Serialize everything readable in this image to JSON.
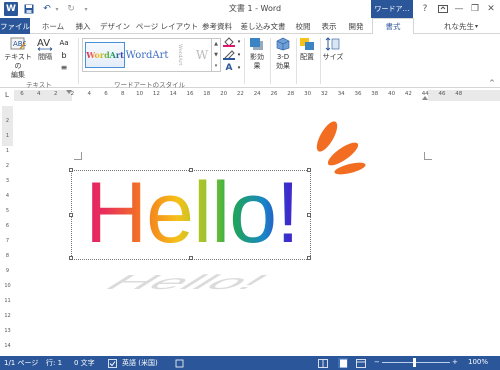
{
  "titlebar": {
    "title": "文書 1 - Word",
    "context_title": "ワードア…",
    "help": "?",
    "minimize": "—",
    "restore": "❐",
    "close": "✕"
  },
  "qat": {
    "word_glyph": "W",
    "save_glyph": "💾",
    "undo_glyph": "↶",
    "redo_glyph": "↻",
    "more_glyph": "▾"
  },
  "tabs": [
    "ファイル",
    "ホーム",
    "挿入",
    "デザイン",
    "ページ レイアウト",
    "参考資料",
    "差し込み文書",
    "校閲",
    "表示",
    "開発",
    "書式"
  ],
  "user_label": "れな先生",
  "ribbon": {
    "text_edit_label": "テキストの\n編集",
    "spacing_label": "間隔",
    "text_group": "テキスト",
    "wordart_group": "ワードアートのスタイル",
    "shadow_label": "影効果",
    "threed_label": "3-D\n効果",
    "arrange_label": "配置",
    "size_label": "サイズ",
    "gallery": [
      "WordArt",
      "WordArt",
      "WordArt",
      "W"
    ],
    "colors": {
      "accent": "#2b579a",
      "fill": "#e0156b",
      "outline": "#2b579a",
      "shadow": "#3b84c4"
    }
  },
  "ruler": {
    "h_ticks": [
      "6",
      "4",
      "2",
      "2",
      "4",
      "6",
      "8",
      "10",
      "12",
      "14",
      "16",
      "18",
      "20",
      "22",
      "24",
      "26",
      "28",
      "30",
      "32",
      "34",
      "36",
      "38",
      "40",
      "42",
      "44",
      "46",
      "48"
    ],
    "v_ticks": [
      "2",
      "1",
      "1",
      "2",
      "3",
      "4",
      "5",
      "6",
      "7",
      "8",
      "9",
      "10",
      "11",
      "12",
      "13",
      "14"
    ]
  },
  "document": {
    "wordart_text": "Hello!",
    "shadow_text": "Hello!"
  },
  "statusbar": {
    "page": "1/1 ページ",
    "line": "行: 1",
    "words": "0 文字",
    "language": "英語 (米国)",
    "zoom": "100%",
    "minus": "−",
    "plus": "+"
  }
}
